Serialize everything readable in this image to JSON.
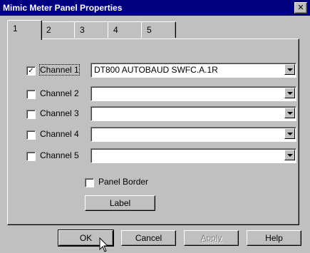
{
  "window": {
    "title": "Mimic Meter Panel Properties",
    "close_glyph": "✕"
  },
  "tabs": [
    {
      "label": "1",
      "active": true
    },
    {
      "label": "2",
      "active": false
    },
    {
      "label": "3",
      "active": false
    },
    {
      "label": "4",
      "active": false
    },
    {
      "label": "5",
      "active": false
    }
  ],
  "channels": [
    {
      "label": "Channel 1",
      "checked": true,
      "value": "DT800 AUTOBAUD SWFC.A.1R"
    },
    {
      "label": "Channel 2",
      "checked": false,
      "value": ""
    },
    {
      "label": "Channel 3",
      "checked": false,
      "value": ""
    },
    {
      "label": "Channel 4",
      "checked": false,
      "value": ""
    },
    {
      "label": "Channel 5",
      "checked": false,
      "value": ""
    }
  ],
  "panel_border": {
    "label": "Panel Border",
    "checked": false
  },
  "label_button": "Label",
  "buttons": {
    "ok": "OK",
    "cancel": "Cancel",
    "apply": "Apply",
    "help": "Help"
  },
  "check_glyph": "✓"
}
